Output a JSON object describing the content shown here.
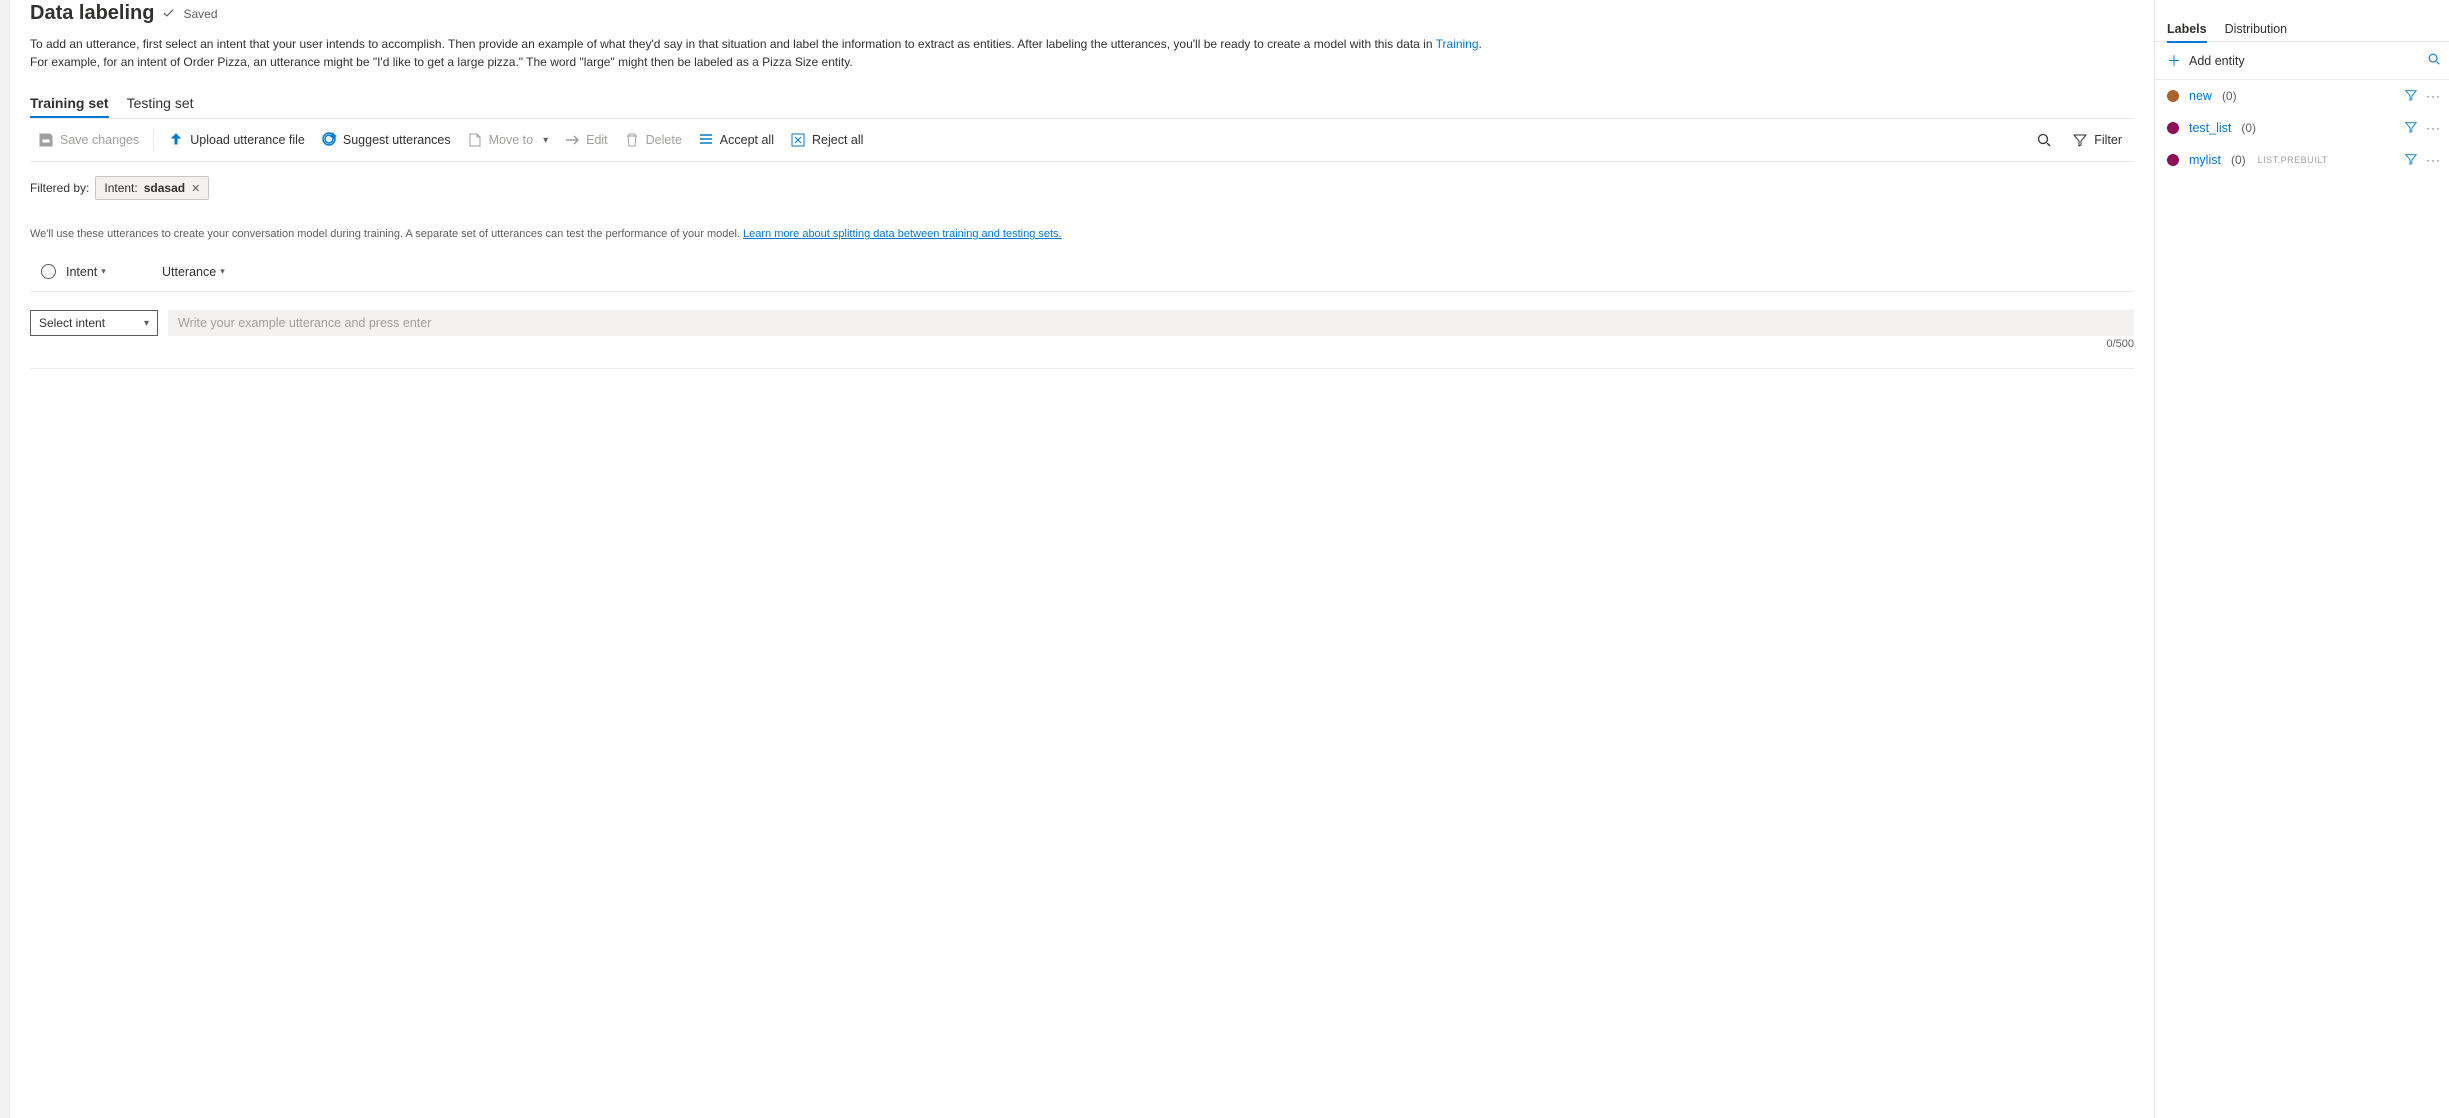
{
  "header": {
    "title": "Data labeling",
    "saved_label": "Saved"
  },
  "description": {
    "line_before_link": "To add an utterance, first select an intent that your user intends to accomplish. Then provide an example of what they'd say in that situation and label the information to extract as entities. After labeling the utterances, you'll be ready to create a model with this data in ",
    "link_text": "Training",
    "line_after_link": ".",
    "line2": "For example, for an intent of Order Pizza, an utterance might be \"I'd like to get a large pizza.\" The word \"large\" might then be labeled as a Pizza Size entity."
  },
  "main_tabs": {
    "training": "Training set",
    "testing": "Testing set"
  },
  "toolbar": {
    "save": "Save changes",
    "upload": "Upload utterance file",
    "suggest": "Suggest utterances",
    "move": "Move to",
    "edit": "Edit",
    "delete": "Delete",
    "accept": "Accept all",
    "reject": "Reject all",
    "filter": "Filter"
  },
  "filtered_by": {
    "label": "Filtered by:",
    "chip_prefix": "Intent: ",
    "chip_value": "sdasad"
  },
  "info": {
    "text_before": "We'll use these utterances to create your conversation model during training. A separate set of utterances can test the performance of your model. ",
    "link": "Learn more about splitting data between training and testing sets."
  },
  "table": {
    "col_intent": "Intent",
    "col_utterance": "Utterance"
  },
  "new_row": {
    "select_placeholder": "Select intent",
    "input_placeholder": "Write your example utterance and press enter",
    "char_count": "0/500"
  },
  "side": {
    "tabs": {
      "labels": "Labels",
      "distribution": "Distribution"
    },
    "add_entity": "Add entity",
    "entities": [
      {
        "name": "new",
        "count": "(0)",
        "color": "#a9632e",
        "badge": ""
      },
      {
        "name": "test_list",
        "count": "(0)",
        "color": "#8a1057",
        "badge": ""
      },
      {
        "name": "mylist",
        "count": "(0)",
        "color": "#8a1057",
        "badge": "LIST.PREBUILT"
      }
    ]
  }
}
